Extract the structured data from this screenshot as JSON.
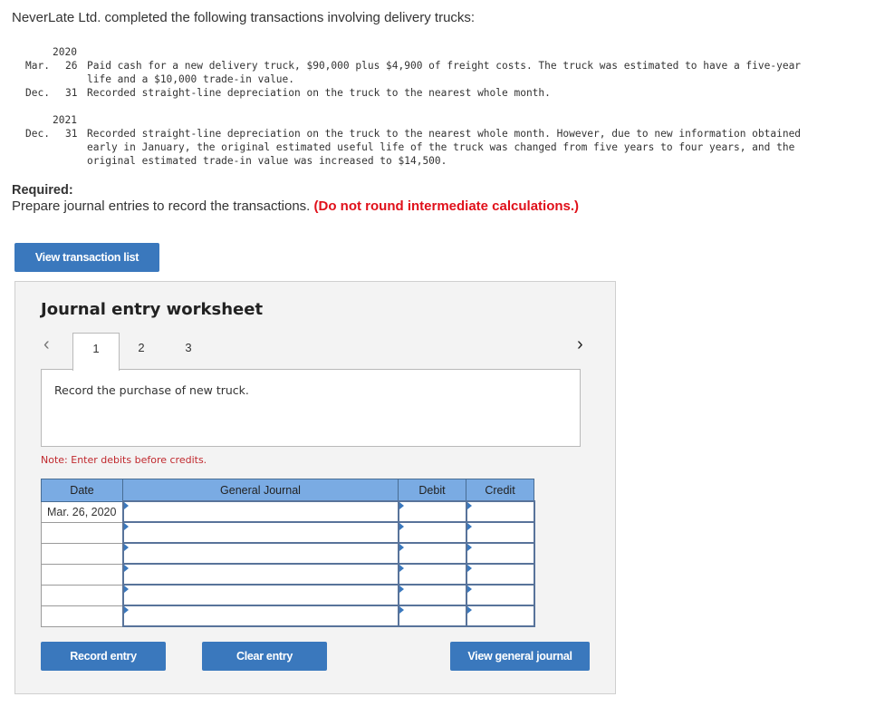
{
  "problem": {
    "intro": "NeverLate Ltd. completed the following transactions involving delivery trucks:",
    "years": [
      {
        "year": "2020",
        "entries": [
          {
            "month": "Mar.",
            "day": "26",
            "lines": [
              "Paid cash for a new delivery truck, $90,000 plus $4,900 of freight costs. The truck was estimated to have a five-year",
              "life and a $10,000 trade-in value."
            ]
          },
          {
            "month": "Dec.",
            "day": "31",
            "lines": [
              "Recorded straight-line depreciation on the truck to the nearest whole month."
            ]
          }
        ]
      },
      {
        "year": "2021",
        "entries": [
          {
            "month": "Dec.",
            "day": "31",
            "lines": [
              "Recorded straight-line depreciation on the truck to the nearest whole month. However, due to new information obtained",
              "early in January, the original estimated useful life of the truck was changed from five years to four years, and the",
              "original estimated trade-in value was increased to $14,500."
            ]
          }
        ]
      }
    ],
    "required_label": "Required:",
    "required_text": "Prepare journal entries to record the transactions.",
    "required_note": "(Do not round intermediate calculations.)"
  },
  "buttons": {
    "view_transaction_list": "View transaction list",
    "record_entry": "Record entry",
    "clear_entry": "Clear entry",
    "view_general_journal": "View general journal"
  },
  "worksheet": {
    "title": "Journal entry worksheet",
    "prev_icon": "‹",
    "next_icon": "›",
    "tabs": [
      "1",
      "2",
      "3"
    ],
    "active_tab": "1",
    "description": "Record the purchase of new truck.",
    "note": "Note: Enter debits before credits.",
    "table": {
      "headers": [
        "Date",
        "General Journal",
        "Debit",
        "Credit"
      ],
      "rows": [
        {
          "date": "Mar. 26, 2020",
          "account": "",
          "debit": "",
          "credit": ""
        },
        {
          "date": "",
          "account": "",
          "debit": "",
          "credit": ""
        },
        {
          "date": "",
          "account": "",
          "debit": "",
          "credit": ""
        },
        {
          "date": "",
          "account": "",
          "debit": "",
          "credit": ""
        },
        {
          "date": "",
          "account": "",
          "debit": "",
          "credit": ""
        },
        {
          "date": "",
          "account": "",
          "debit": "",
          "credit": ""
        }
      ]
    }
  },
  "colors": {
    "button_blue": "#3a78bd",
    "header_blue": "#7aabe3",
    "note_red": "#c0282d",
    "required_red": "#e0101a"
  }
}
